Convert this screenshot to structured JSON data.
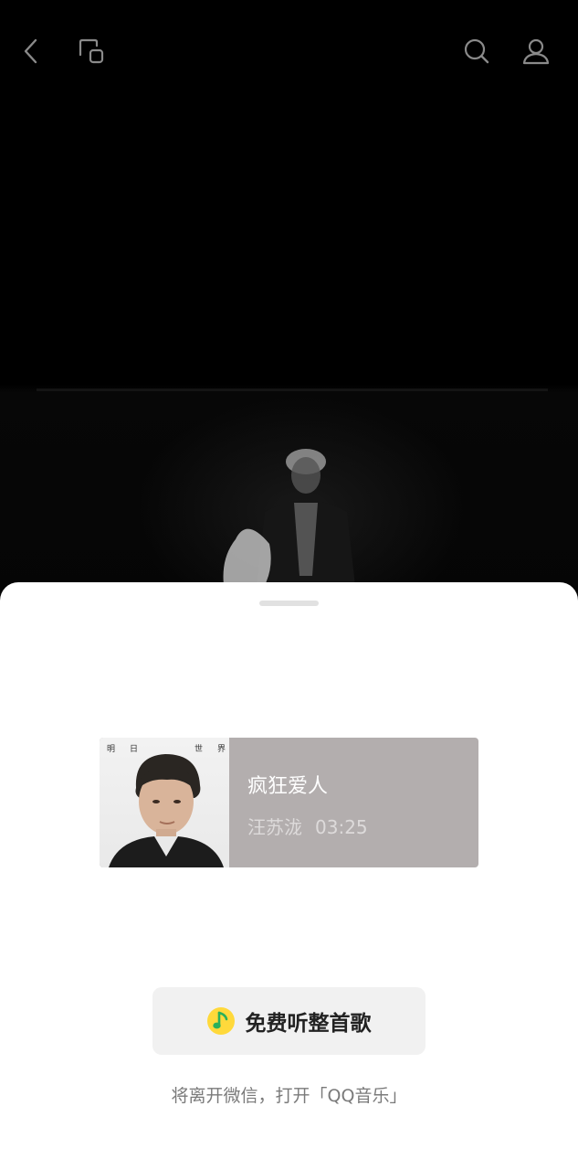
{
  "top_bar": {
    "back_icon": "chevron-left-icon",
    "floating_window_icon": "floating-window-icon",
    "search_icon": "search-icon",
    "profile_icon": "user-icon"
  },
  "song": {
    "cover_text_left": "明",
    "cover_text_mid": "日",
    "cover_text_right1": "世",
    "cover_text_right2": "界",
    "title": "疯狂爱人",
    "artist": "汪苏泷",
    "duration": "03:25"
  },
  "cta": {
    "icon": "qq-music-icon",
    "label": "免费听整首歌"
  },
  "hint": "将离开微信，打开「QQ音乐」",
  "colors": {
    "card_bg": "#b3aeae",
    "qq_music_yellow": "#ffd93b",
    "qq_music_green": "#29b05b"
  }
}
